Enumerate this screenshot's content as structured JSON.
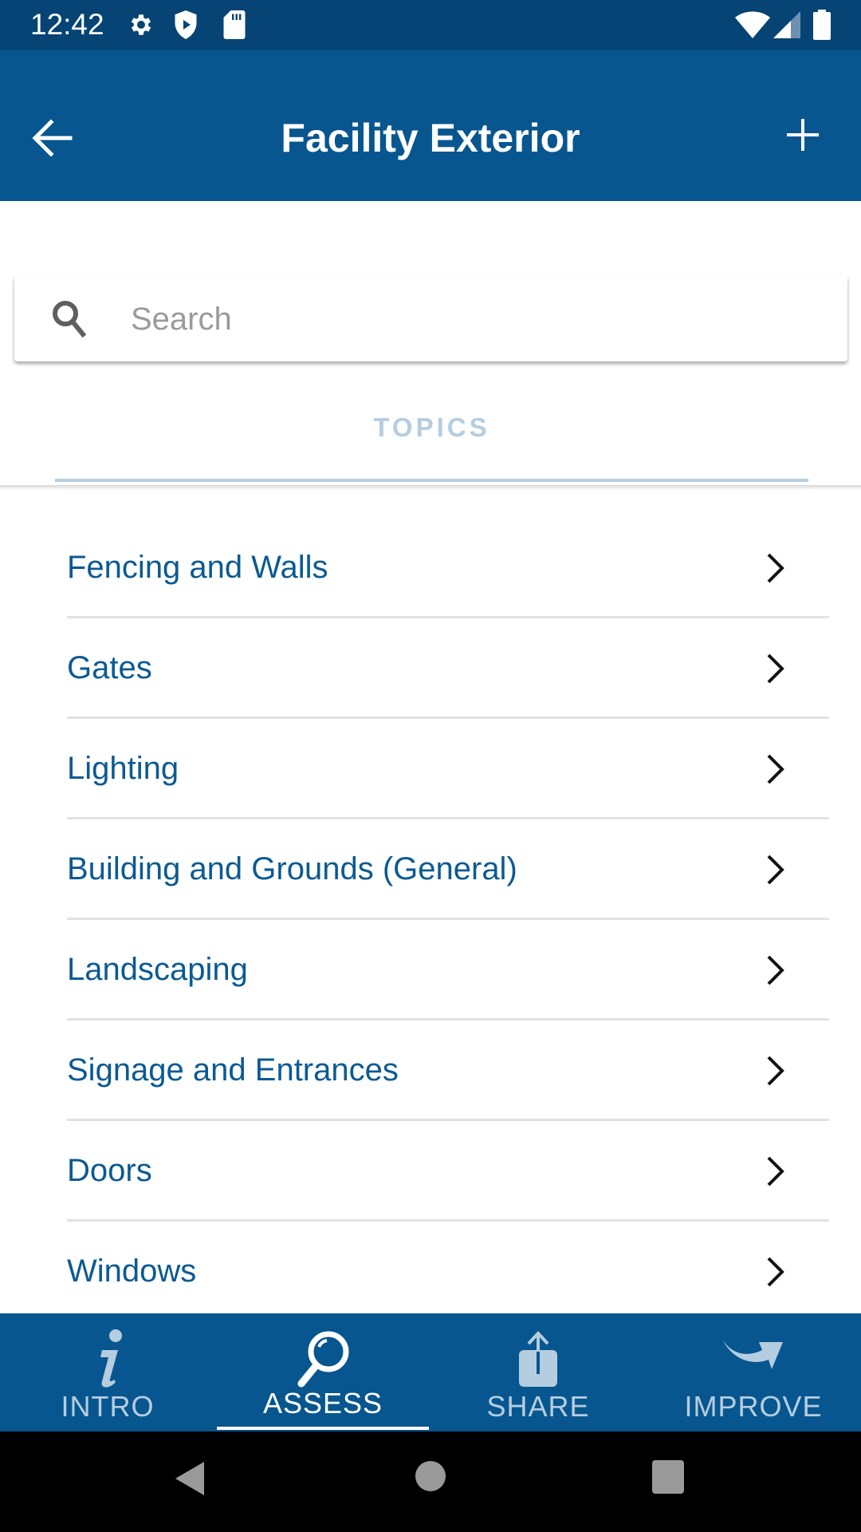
{
  "status_bar": {
    "time": "12:42",
    "left_icons": [
      "settings-gear-icon",
      "shield-play-icon",
      "sd-card-icon"
    ],
    "right_icons": [
      "wifi-icon",
      "cell-signal-icon",
      "battery-icon"
    ]
  },
  "app_bar": {
    "title": "Facility Exterior",
    "back_icon": "arrow-left-icon",
    "action_icon": "plus-icon"
  },
  "search": {
    "placeholder": "Search",
    "value": "",
    "icon": "search-icon"
  },
  "tabs": [
    {
      "label": "TOPICS",
      "selected": true
    }
  ],
  "topics": [
    {
      "label": "Fencing and Walls"
    },
    {
      "label": "Gates"
    },
    {
      "label": "Lighting"
    },
    {
      "label": "Building and Grounds (General)"
    },
    {
      "label": "Landscaping"
    },
    {
      "label": "Signage and Entrances"
    },
    {
      "label": "Doors"
    },
    {
      "label": "Windows"
    }
  ],
  "bottom_nav": {
    "items": [
      {
        "label": "INTRO",
        "icon": "info-icon",
        "active": false
      },
      {
        "label": "ASSESS",
        "icon": "magnifier-icon",
        "active": true
      },
      {
        "label": "SHARE",
        "icon": "share-upload-icon",
        "active": false
      },
      {
        "label": "IMPROVE",
        "icon": "curved-arrow-icon",
        "active": false
      }
    ]
  },
  "colors": {
    "status_bar": "#054474",
    "primary": "#07568f",
    "topic_text": "#0b5a93",
    "inactive_nav": "#b5cde0",
    "divider": "#e2e2e2"
  }
}
